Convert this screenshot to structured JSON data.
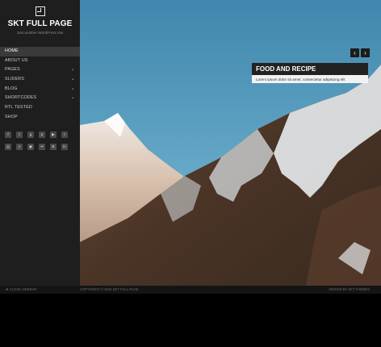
{
  "brand": {
    "title": "SKT FULL PAGE",
    "tagline": "Just another WordPress site"
  },
  "nav": [
    {
      "label": "HOME",
      "active": true,
      "dropdown": false
    },
    {
      "label": "ABOUT US",
      "dropdown": false
    },
    {
      "label": "PAGES",
      "dropdown": true
    },
    {
      "label": "SLIDERS",
      "dropdown": true
    },
    {
      "label": "BLOG",
      "dropdown": true
    },
    {
      "label": "SHORTCODES",
      "dropdown": true
    },
    {
      "label": "RTL TESTED",
      "dropdown": false
    },
    {
      "label": "SHOP",
      "dropdown": false
    }
  ],
  "social_icons": [
    "facebook-icon",
    "twitter-icon",
    "google-plus-icon",
    "pinterest-icon",
    "youtube-icon",
    "tumblr-icon",
    "instagram-icon",
    "vimeo-icon",
    "dribbble-icon",
    "flickr-icon",
    "behance-icon",
    "linkedin-icon"
  ],
  "slider": {
    "prev": "‹",
    "next": "›",
    "title": "FOOD AND RECIPE",
    "text": "Lorem ipsum dolor sit amet, consectetur adipiscing elit"
  },
  "footer": {
    "close_label": "CLOSE SIDEBAR",
    "copyright": "COPYRIGHT © 2016 SKT FULL PAGE",
    "design": "DESIGN BY SKT THEMES"
  },
  "colors": {
    "sidebar": "#1e1e1e",
    "sky_top": "#3f87ad",
    "sky_bottom": "#7fbdd8",
    "caption_title_bg": "#222222"
  }
}
